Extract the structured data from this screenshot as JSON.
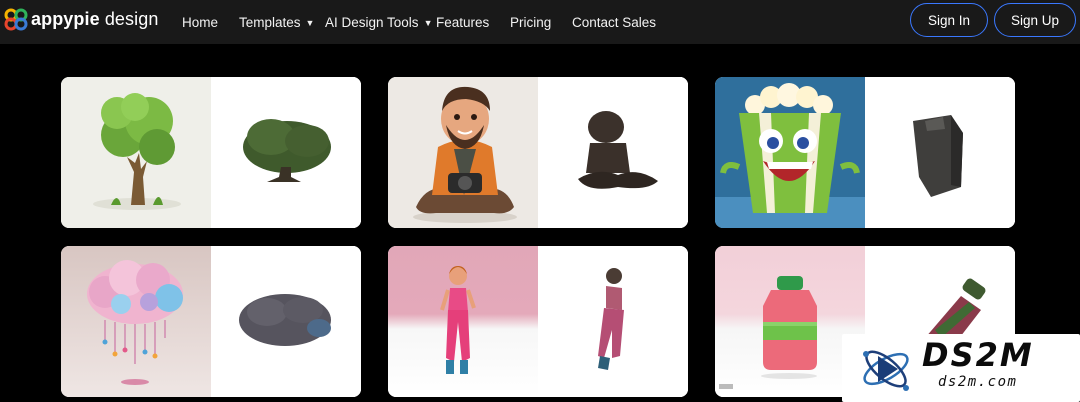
{
  "brand": {
    "name_bold": "appypie",
    "name_rest": " design"
  },
  "nav": {
    "items": [
      {
        "label": "Home",
        "dropdown": false
      },
      {
        "label": "Templates",
        "dropdown": true
      },
      {
        "label": "AI Design Tools",
        "dropdown": true
      },
      {
        "label": "Features",
        "dropdown": false
      },
      {
        "label": "Pricing",
        "dropdown": false
      },
      {
        "label": "Contact Sales",
        "dropdown": false
      }
    ],
    "caret": "▼"
  },
  "auth": {
    "sign_in": "Sign In",
    "sign_up": "Sign Up"
  },
  "gallery": {
    "cards": [
      {
        "subject": "tree",
        "left_bg": "#efefe9"
      },
      {
        "subject": "man-with-camera",
        "left_bg": "#ede9e4"
      },
      {
        "subject": "popcorn-character",
        "left_bg": "#2f6f9c"
      },
      {
        "subject": "brain-cloud",
        "left_bg": "#d8c6c2"
      },
      {
        "subject": "woman-standing",
        "left_bg": "#e1a7b8"
      },
      {
        "subject": "bottle",
        "left_bg": "#f2cfd8"
      }
    ]
  },
  "watermark": {
    "title": "DS2M",
    "url": "ds2m.com"
  },
  "colors": {
    "navbar": "#191919",
    "accent": "#3a78ff",
    "background": "#000000"
  }
}
